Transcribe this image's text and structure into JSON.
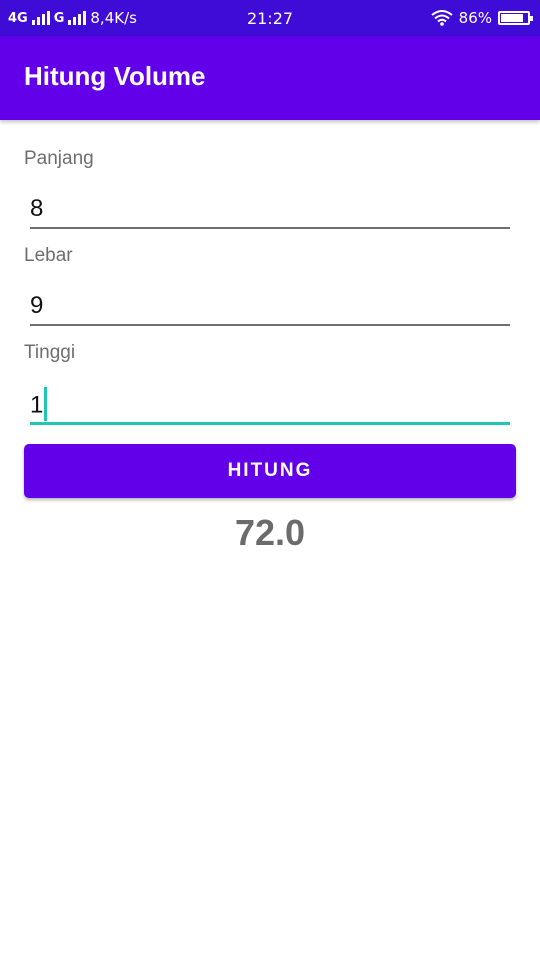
{
  "status_bar": {
    "network_1": "4G",
    "network_2": "G",
    "speed": "8,4K/s",
    "time": "21:27",
    "battery": "86%",
    "battery_level": 0.86,
    "icons": [
      "signal-icon",
      "wifi-icon",
      "battery-icon"
    ]
  },
  "app_bar": {
    "title": "Hitung Volume",
    "color": "#6200ea"
  },
  "form": {
    "panjang": {
      "label": "Panjang",
      "value": "8"
    },
    "lebar": {
      "label": "Lebar",
      "value": "9"
    },
    "tinggi": {
      "label": "Tinggi",
      "value": "1"
    }
  },
  "button": {
    "label": "HITUNG",
    "color": "#6200ea"
  },
  "result": {
    "value": "72.0"
  },
  "colors": {
    "status_bar": "#3f0bd6",
    "accent": "#1ec8b0"
  }
}
